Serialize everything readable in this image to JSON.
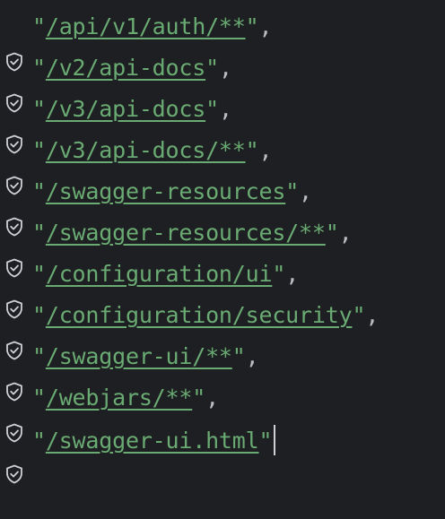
{
  "editor": {
    "gutter_icon": "shield-check-icon",
    "colors": {
      "background": "#1e1f22",
      "string": "#6aab73",
      "punctuation": "#bcbec4",
      "icon": "#ced0d6"
    },
    "lines": [
      {
        "path": "/api/v1/auth/**",
        "suffix": ","
      },
      {
        "path": "/v2/api-docs",
        "suffix": ","
      },
      {
        "path": "/v3/api-docs",
        "suffix": ","
      },
      {
        "path": "/v3/api-docs/**",
        "suffix": ","
      },
      {
        "path": "/swagger-resources",
        "suffix": ","
      },
      {
        "path": "/swagger-resources/**",
        "suffix": ","
      },
      {
        "path": "/configuration/ui",
        "suffix": ","
      },
      {
        "path": "/configuration/security",
        "suffix": ","
      },
      {
        "path": "/swagger-ui/**",
        "suffix": ","
      },
      {
        "path": "/webjars/**",
        "suffix": ","
      },
      {
        "path": "/swagger-ui.html",
        "suffix": ""
      }
    ]
  }
}
